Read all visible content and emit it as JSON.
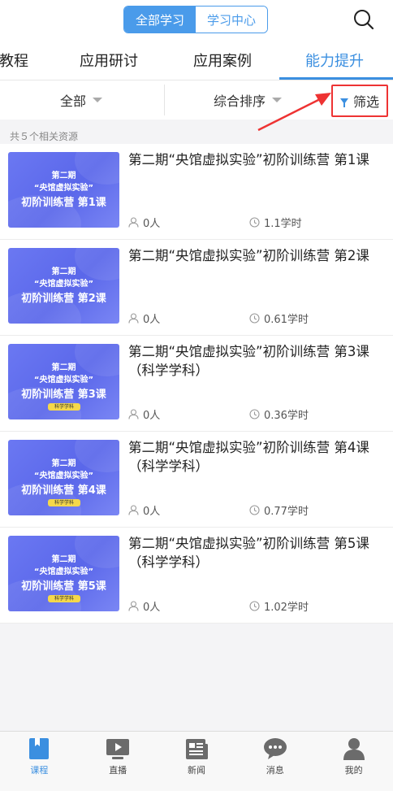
{
  "header": {
    "segments": [
      "全部学习",
      "学习中心"
    ],
    "active_segment": 0
  },
  "tabs": [
    "教程",
    "应用研讨",
    "应用案例",
    "能力提升"
  ],
  "active_tab": 3,
  "filters": {
    "all_label": "全部",
    "sort_label": "综合排序",
    "screen_label": "筛选"
  },
  "result_count": "共５个相关资源",
  "courses": [
    {
      "title": "第二期“央馆虚拟实验”初阶训练营 第1课",
      "thumb_line1": "第二期",
      "thumb_line2": "“央馆虚拟实验”",
      "thumb_line3": "初阶训练营 第1课",
      "thumb_tag": "",
      "learners": "0人",
      "hours": "1.1学时"
    },
    {
      "title": "第二期“央馆虚拟实验”初阶训练营 第2课",
      "thumb_line1": "第二期",
      "thumb_line2": "“央馆虚拟实验”",
      "thumb_line3": "初阶训练营 第2课",
      "thumb_tag": "",
      "learners": "0人",
      "hours": "0.61学时"
    },
    {
      "title": "第二期“央馆虚拟实验”初阶训练营 第3课 （科学学科）",
      "thumb_line1": "第二期",
      "thumb_line2": "“央馆虚拟实验”",
      "thumb_line3": "初阶训练营 第3课",
      "thumb_tag": "科学学科",
      "learners": "0人",
      "hours": "0.36学时"
    },
    {
      "title": "第二期“央馆虚拟实验”初阶训练营 第4课 （科学学科）",
      "thumb_line1": "第二期",
      "thumb_line2": "“央馆虚拟实验”",
      "thumb_line3": "初阶训练营 第4课",
      "thumb_tag": "科学学科",
      "learners": "0人",
      "hours": "0.77学时"
    },
    {
      "title": "第二期“央馆虚拟实验”初阶训练营 第5课 （科学学科）",
      "thumb_line1": "第二期",
      "thumb_line2": "“央馆虚拟实验”",
      "thumb_line3": "初阶训练营 第5课",
      "thumb_tag": "科学学科",
      "learners": "0人",
      "hours": "1.02学时"
    }
  ],
  "tabbar": [
    {
      "label": "课程",
      "icon": "book-icon"
    },
    {
      "label": "直播",
      "icon": "live-icon"
    },
    {
      "label": "新闻",
      "icon": "news-icon"
    },
    {
      "label": "消息",
      "icon": "message-icon"
    },
    {
      "label": "我的",
      "icon": "user-icon"
    }
  ],
  "active_tabbar": 0,
  "colors": {
    "accent": "#3b8fe0",
    "highlight_box": "#ee3333"
  }
}
